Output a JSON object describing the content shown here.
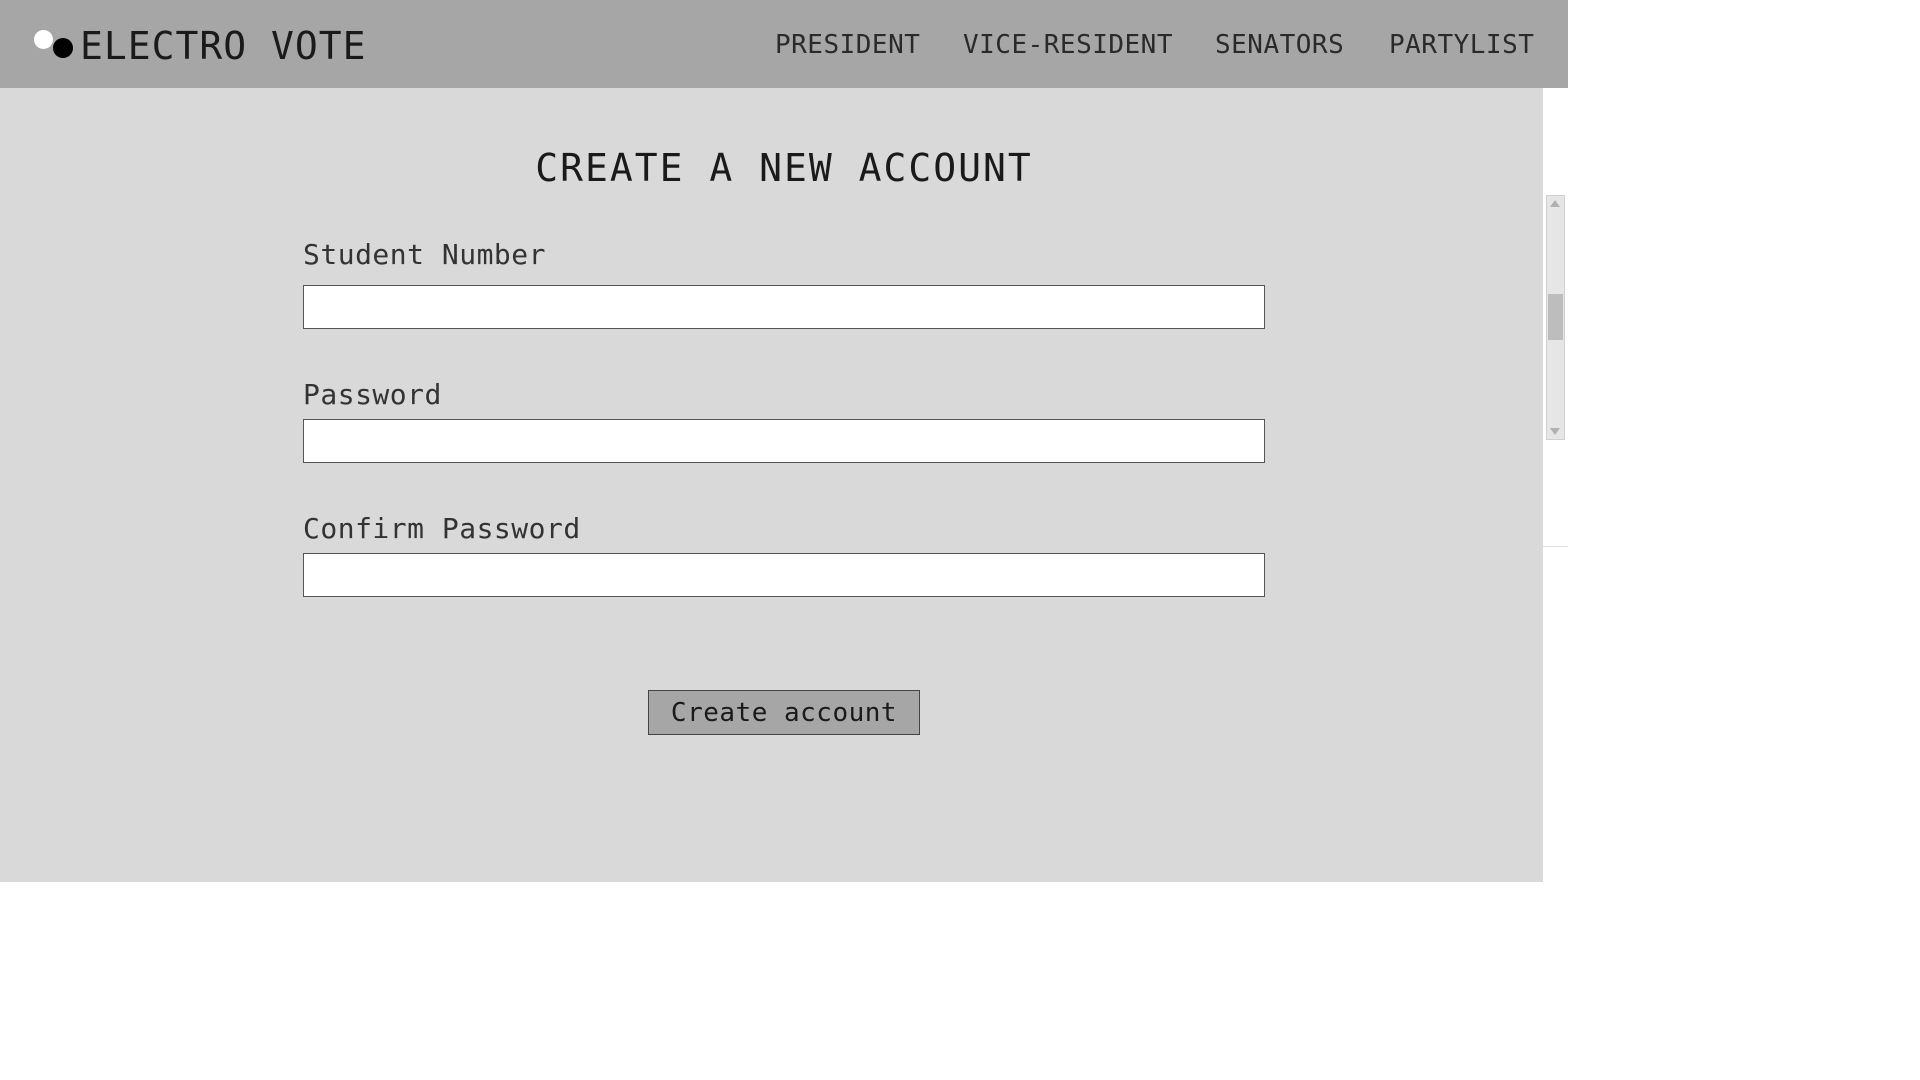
{
  "brand": {
    "name": "ELECTRO VOTE"
  },
  "nav": {
    "items": [
      {
        "label": "PRESIDENT"
      },
      {
        "label": "VICE-RESIDENT"
      },
      {
        "label": "SENATORS"
      },
      {
        "label": "PARTYLIST"
      }
    ]
  },
  "form": {
    "title": "CREATE A NEW ACCOUNT",
    "student_number_label": "Student Number",
    "student_number_value": "",
    "password_label": "Password",
    "password_value": "",
    "confirm_password_label": "Confirm Password",
    "confirm_password_value": "",
    "submit_label": "Create account"
  },
  "colors": {
    "navbar": "#a6a6a6",
    "page_background": "#d9d9d9",
    "button": "#a6a6a6"
  }
}
